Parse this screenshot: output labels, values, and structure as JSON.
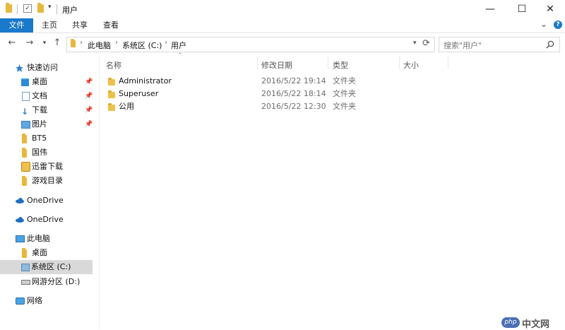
{
  "titlebar": {
    "title": "用户",
    "minimize": "—",
    "maximize": "☐",
    "close": "✕",
    "expand_ribbon": "⌄",
    "help": "?"
  },
  "ribbon": {
    "tabs": [
      "文件",
      "主页",
      "共享",
      "查看"
    ]
  },
  "address": {
    "crumbs": [
      "此电脑",
      "系统区 (C:)",
      "用户"
    ],
    "search_placeholder": "搜索\"用户\""
  },
  "sidebar": {
    "quick_access": "快速访问",
    "quick_items": [
      {
        "label": "桌面",
        "pinned": true
      },
      {
        "label": "文档",
        "pinned": true
      },
      {
        "label": "下载",
        "pinned": true
      },
      {
        "label": "图片",
        "pinned": true
      },
      {
        "label": "BT5",
        "pinned": false
      },
      {
        "label": "国伟",
        "pinned": false
      },
      {
        "label": "迅雷下载",
        "pinned": false
      },
      {
        "label": "游戏目录",
        "pinned": false
      }
    ],
    "onedrive_1": "OneDrive",
    "onedrive_2": "OneDrive",
    "this_pc": "此电脑",
    "pc_items": [
      "桌面",
      "系统区 (C:)",
      "网游分区 (D:)"
    ],
    "network": "网络"
  },
  "columns": {
    "name": "名称",
    "date": "修改日期",
    "type": "类型",
    "size": "大小"
  },
  "files": [
    {
      "name": "Administrator",
      "date": "2016/5/22 19:14",
      "type": "文件夹"
    },
    {
      "name": "Superuser",
      "date": "2016/5/22 18:14",
      "type": "文件夹"
    },
    {
      "name": "公用",
      "date": "2016/5/22 12:30",
      "type": "文件夹"
    }
  ],
  "watermark": {
    "brand": "php",
    "text": "中文网"
  },
  "colors": {
    "accent": "#1979ca",
    "folder": "#f0c04a",
    "selected": "#d9d9d9"
  }
}
